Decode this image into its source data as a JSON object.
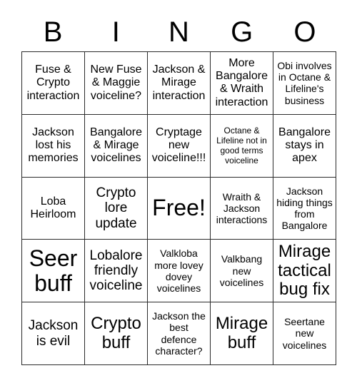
{
  "header": {
    "letters": [
      "B",
      "I",
      "N",
      "G",
      "O"
    ]
  },
  "grid": {
    "rows": 5,
    "columns": 5,
    "cells": [
      {
        "text": "Fuse & Crypto interaction",
        "size": "sz-md",
        "free": false
      },
      {
        "text": "New Fuse & Maggie voiceline?",
        "size": "sz-md",
        "free": false
      },
      {
        "text": "Jackson & Mirage interaction",
        "size": "sz-md",
        "free": false
      },
      {
        "text": "More Bangalore & Wraith interaction",
        "size": "sz-md",
        "free": false
      },
      {
        "text": "Obi involves in Octane & Lifeline's business",
        "size": "sz-sm",
        "free": false
      },
      {
        "text": "Jackson lost his memories",
        "size": "sz-md",
        "free": false
      },
      {
        "text": "Bangalore & Mirage voicelines",
        "size": "sz-md",
        "free": false
      },
      {
        "text": "Cryptage new voiceline!!!",
        "size": "sz-md",
        "free": false
      },
      {
        "text": "Octane & Lifeline not in good terms voiceline",
        "size": "sz-xs",
        "free": false
      },
      {
        "text": "Bangalore stays in apex",
        "size": "sz-md",
        "free": false
      },
      {
        "text": "Loba Heirloom",
        "size": "sz-md",
        "free": false
      },
      {
        "text": "Crypto lore update",
        "size": "sz-lg",
        "free": false
      },
      {
        "text": "Free!",
        "size": "sz-xxl",
        "free": true
      },
      {
        "text": "Wraith & Jackson interactions",
        "size": "sz-sm",
        "free": false
      },
      {
        "text": "Jackson hiding things from Bangalore",
        "size": "sz-sm",
        "free": false
      },
      {
        "text": "Seer buff",
        "size": "sz-xxl",
        "free": false
      },
      {
        "text": "Lobalore friendly voiceline",
        "size": "sz-lg",
        "free": false
      },
      {
        "text": "Valkloba more lovey dovey voicelines",
        "size": "sz-sm",
        "free": false
      },
      {
        "text": "Valkbang new voicelines",
        "size": "sz-sm",
        "free": false
      },
      {
        "text": "Mirage tactical bug fix",
        "size": "sz-xl",
        "free": false
      },
      {
        "text": "Jackson is evil",
        "size": "sz-lg",
        "free": false
      },
      {
        "text": "Crypto buff",
        "size": "sz-xl",
        "free": false
      },
      {
        "text": "Jackson the best defence character?",
        "size": "sz-sm",
        "free": false
      },
      {
        "text": "Mirage buff",
        "size": "sz-xl",
        "free": false
      },
      {
        "text": "Seertane new voicelines",
        "size": "sz-sm",
        "free": false
      }
    ]
  }
}
